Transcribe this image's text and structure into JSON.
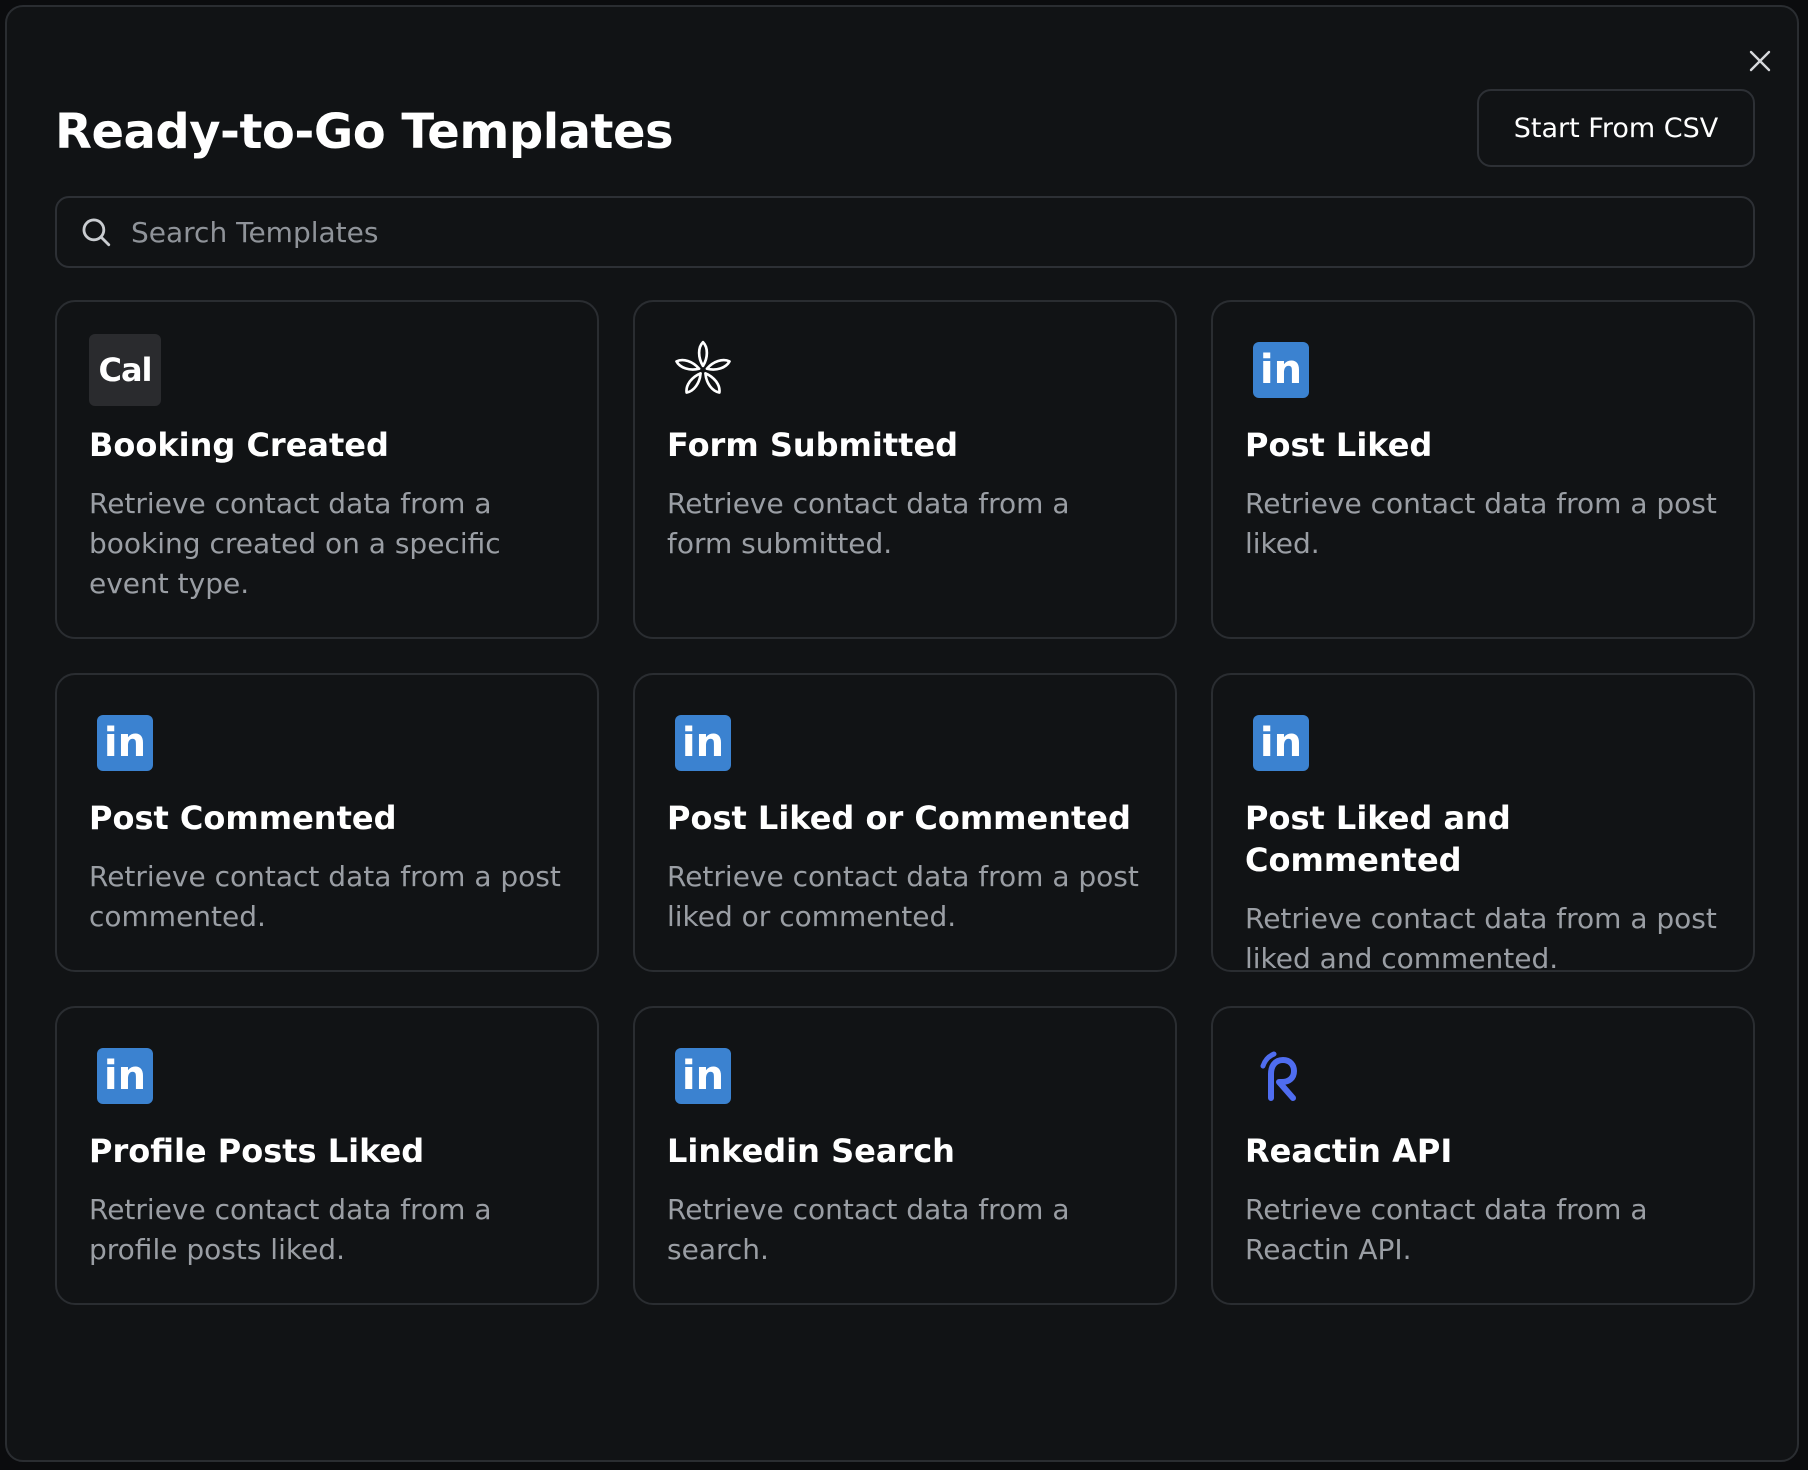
{
  "modal": {
    "title": "Ready-to-Go Templates",
    "start_csv_label": "Start From CSV",
    "search_placeholder": "Search Templates",
    "close_icon": "close-icon"
  },
  "colors": {
    "background": "#111315",
    "border": "#2a2d31",
    "text_primary": "#ffffff",
    "text_secondary": "#9a9ea4",
    "linkedin_blue": "#3b82d0",
    "reactin_blue": "#4f6df0",
    "cal_badge": "#2a2b2e"
  },
  "templates": [
    {
      "title": "Booking Created",
      "description": "Retrieve contact data from a booking created on a specific event type.",
      "icon": "cal-icon",
      "icon_text": "Cal"
    },
    {
      "title": "Form Submitted",
      "description": "Retrieve contact data from a form submitted.",
      "icon": "flower-asterisk-icon"
    },
    {
      "title": "Post Liked",
      "description": "Retrieve contact data from a post liked.",
      "icon": "linkedin-icon",
      "icon_text": "in"
    },
    {
      "title": "Post Commented",
      "description": "Retrieve contact data from a post commented.",
      "icon": "linkedin-icon",
      "icon_text": "in"
    },
    {
      "title": "Post Liked or Commented",
      "description": "Retrieve contact data from a post liked or commented.",
      "icon": "linkedin-icon",
      "icon_text": "in"
    },
    {
      "title": "Post Liked and Commented",
      "description": "Retrieve contact data from a post liked and commented.",
      "icon": "linkedin-icon",
      "icon_text": "in"
    },
    {
      "title": "Profile Posts Liked",
      "description": "Retrieve contact data from a profile posts liked.",
      "icon": "linkedin-icon",
      "icon_text": "in"
    },
    {
      "title": "Linkedin Search",
      "description": "Retrieve contact data from a search.",
      "icon": "linkedin-icon",
      "icon_text": "in"
    },
    {
      "title": "Reactin API",
      "description": "Retrieve contact data from a Reactin API.",
      "icon": "reactin-logo-icon"
    }
  ]
}
